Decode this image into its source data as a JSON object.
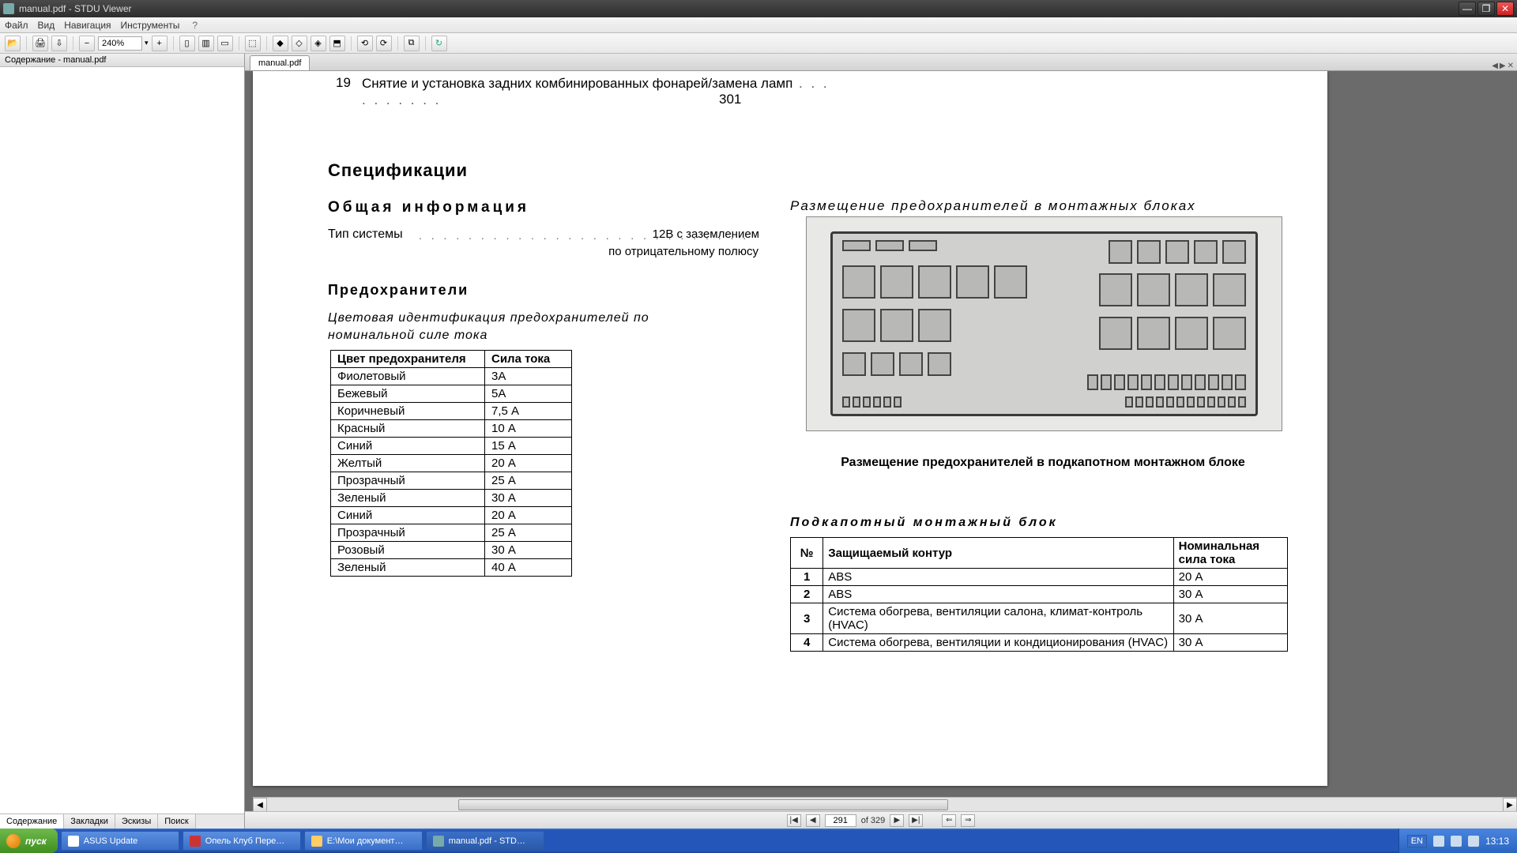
{
  "window": {
    "title": "manual.pdf - STDU Viewer"
  },
  "menu": {
    "file": "Файл",
    "view": "Вид",
    "nav": "Навигация",
    "tools": "Инструменты",
    "help": "?"
  },
  "toolbar": {
    "zoom": "240%"
  },
  "sidebar": {
    "header": "Содержание - manual.pdf",
    "tabs": [
      "Содержание",
      "Закладки",
      "Эскизы",
      "Поиск"
    ]
  },
  "doctab": "manual.pdf",
  "page": {
    "toc_num": "19",
    "toc_text": "Снятие и установка задних комбинированных фонарей/замена ламп",
    "toc_page": "301",
    "h_spec": "Спецификации",
    "h_gen": "Общая информация",
    "sys_label": "Тип системы",
    "sys_val": "12В с заземлением",
    "sys_val2": "по отрицательному полюсу",
    "h_fuse": "Предохранители",
    "h_colorid": "Цветовая идентификация предохранителей по номинальной силе тока",
    "tbl1_h1": "Цвет предохранителя",
    "tbl1_h2": "Сила тока",
    "tbl1_rows": [
      [
        "Фиолетовый",
        "3A"
      ],
      [
        "Бежевый",
        "5A"
      ],
      [
        "Коричневый",
        "7,5 А"
      ],
      [
        "Красный",
        "10 А"
      ],
      [
        "Синий",
        "15 А"
      ],
      [
        "Желтый",
        "20 А"
      ],
      [
        "Прозрачный",
        "25 А"
      ],
      [
        "Зеленый",
        "30 А"
      ],
      [
        "Синий",
        "20 А"
      ],
      [
        "Прозрачный",
        "25 А"
      ],
      [
        "Розовый",
        "30 А"
      ],
      [
        "Зеленый",
        "40 А"
      ]
    ],
    "h_placement": "Размещение предохранителей в монтажных блоках",
    "caption": "Размещение предохранителей в подкапотном монтажном блоке",
    "h_underhood": "Подкапотный монтажный блок",
    "tbl2_h1": "№",
    "tbl2_h2": "Защищаемый контур",
    "tbl2_h3": "Номинальная сила тока",
    "tbl2_rows": [
      [
        "1",
        "ABS",
        "20 А"
      ],
      [
        "2",
        "ABS",
        "30 А"
      ],
      [
        "3",
        "Система обогрева, вентиляции салона, климат-контроль (HVAC)",
        "30 А"
      ],
      [
        "4",
        "Система обогрева, вентиляции и кондиционирования (HVAC)",
        "30 А"
      ]
    ]
  },
  "pager": {
    "current": "291",
    "of": "of 329"
  },
  "taskbar": {
    "start": "пуск",
    "items": [
      "ASUS Update",
      "Опель Клуб Пере…",
      "E:\\Мои документ…",
      "manual.pdf - STD…"
    ],
    "lang": "EN",
    "time": "13:13"
  }
}
